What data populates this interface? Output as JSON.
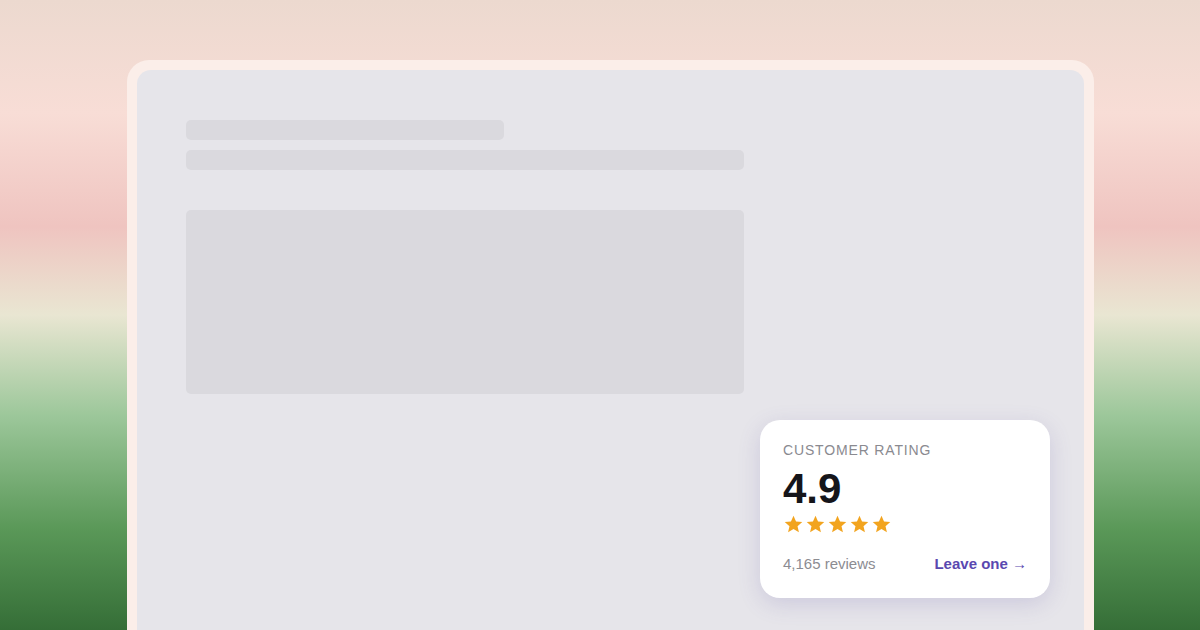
{
  "rating": {
    "label": "CUSTOMER RATING",
    "value": "4.9",
    "stars": 5,
    "reviews": "4,165 reviews",
    "action": "Leave one →"
  }
}
